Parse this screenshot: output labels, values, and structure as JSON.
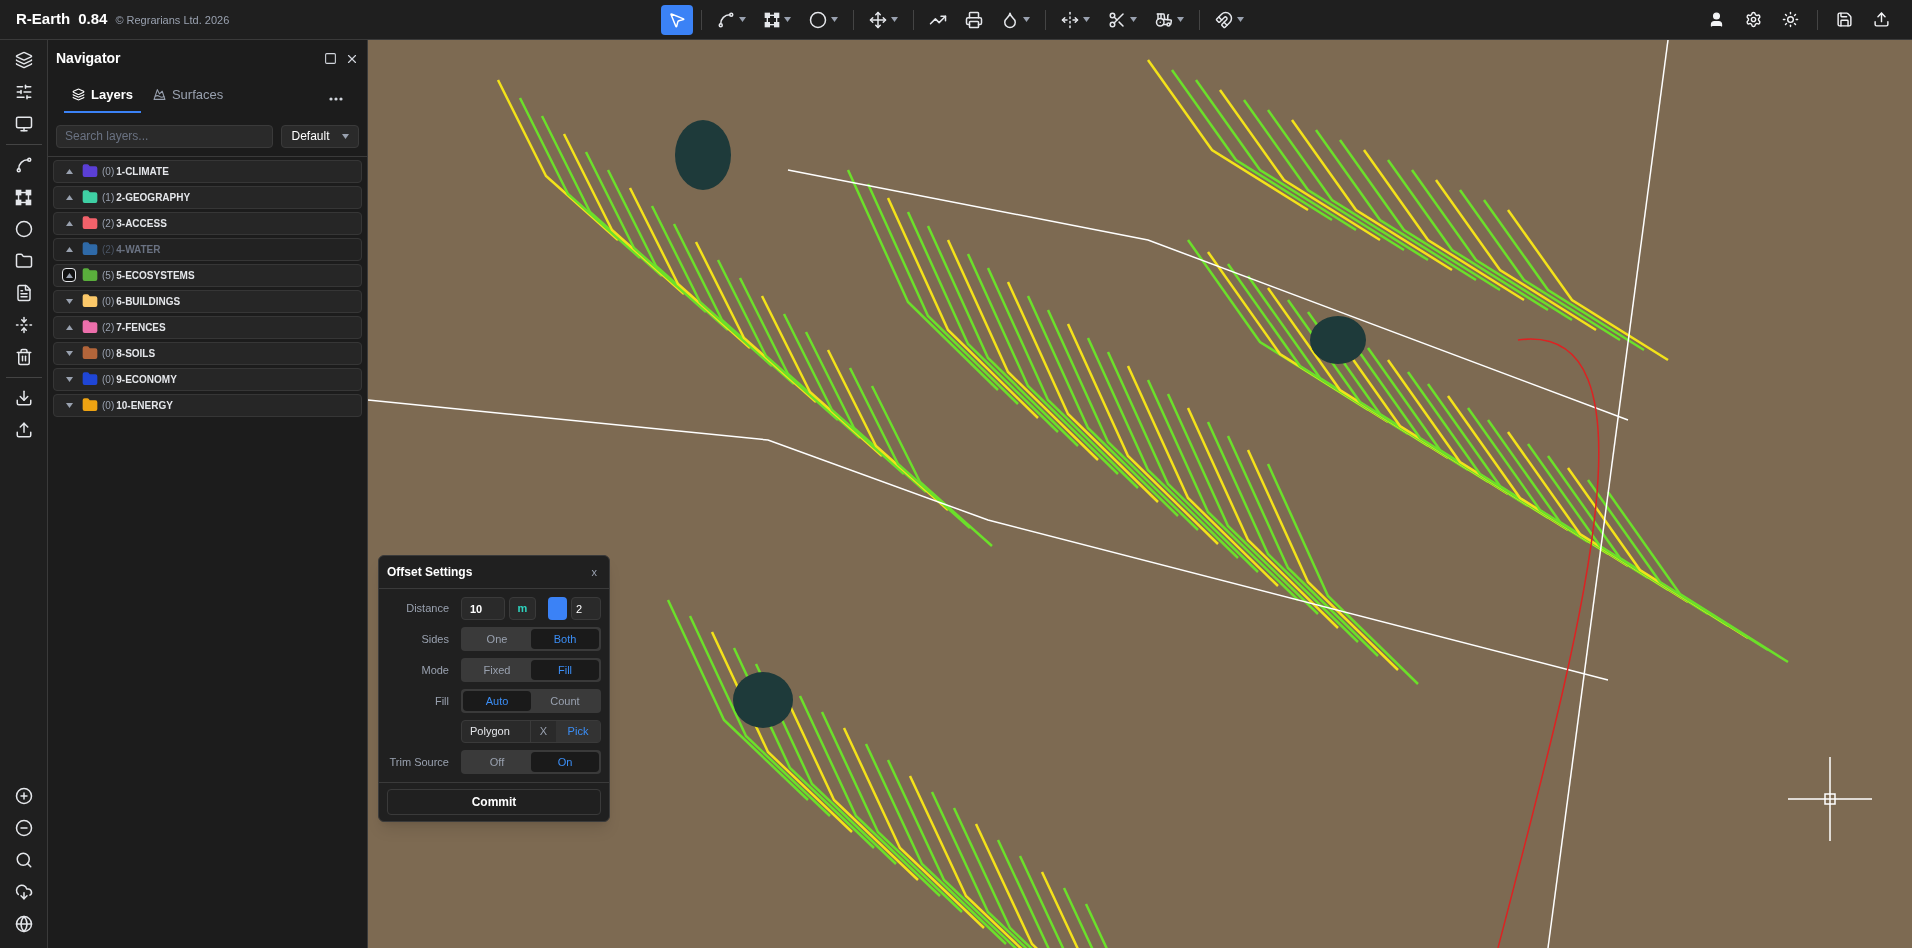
{
  "app": {
    "name": "R-Earth",
    "version": "0.84",
    "copyright": "© Regrarians Ltd. 2026"
  },
  "toolbar": [
    [
      {
        "selected": true,
        "dropdown": false
      }
    ],
    [
      {
        "selected": false,
        "dropdown": true
      },
      {
        "selected": false,
        "dropdown": true
      },
      {
        "selected": false,
        "dropdown": true
      }
    ],
    [
      {
        "selected": false,
        "dropdown": true
      }
    ],
    [
      {
        "selected": false,
        "dropdown": false
      },
      {
        "selected": false,
        "dropdown": false
      },
      {
        "selected": false,
        "dropdown": true
      }
    ],
    [
      {
        "selected": false,
        "dropdown": true
      },
      {
        "selected": false,
        "dropdown": true
      },
      {
        "selected": false,
        "dropdown": true
      }
    ],
    [
      {
        "selected": false,
        "dropdown": true
      }
    ]
  ],
  "navigator": {
    "title": "Navigator",
    "tabs": [
      {
        "label": "Layers",
        "selected": true
      },
      {
        "label": "Surfaces",
        "selected": false
      }
    ],
    "search": {
      "placeholder": "Search layers..."
    },
    "preset": "Default",
    "layers": [
      {
        "count": "(0)",
        "name": "1-CLIMATE",
        "color": "#5b3fd6",
        "expanded": true,
        "visible": true,
        "selected": false
      },
      {
        "count": "(1)",
        "name": "2-GEOGRAPHY",
        "color": "#3fd0a4",
        "expanded": true,
        "visible": true,
        "selected": false
      },
      {
        "count": "(2)",
        "name": "3-ACCESS",
        "color": "#f2626b",
        "expanded": true,
        "visible": true,
        "selected": false
      },
      {
        "count": "(2)",
        "name": "4-WATER",
        "color": "#2f6aa8",
        "expanded": true,
        "visible": false,
        "selected": false
      },
      {
        "count": "(5)",
        "name": "5-ECOSYSTEMS",
        "color": "#5aaf3c",
        "expanded": true,
        "visible": true,
        "selected": true
      },
      {
        "count": "(0)",
        "name": "6-BUILDINGS",
        "color": "#fcc96a",
        "expanded": false,
        "visible": true,
        "selected": false
      },
      {
        "count": "(2)",
        "name": "7-FENCES",
        "color": "#ec6fab",
        "expanded": true,
        "visible": true,
        "selected": false
      },
      {
        "count": "(0)",
        "name": "8-SOILS",
        "color": "#b3653a",
        "expanded": false,
        "visible": true,
        "selected": false
      },
      {
        "count": "(0)",
        "name": "9-ECONOMY",
        "color": "#1f46d6",
        "expanded": false,
        "visible": true,
        "selected": false
      },
      {
        "count": "(0)",
        "name": "10-ENERGY",
        "color": "#eea312",
        "expanded": false,
        "visible": true,
        "selected": false
      }
    ]
  },
  "offset_settings": {
    "title": "Offset Settings",
    "close": "x",
    "distance": {
      "label": "Distance",
      "value": "10",
      "unit": "m",
      "color": "#3b82f6",
      "count": "2"
    },
    "toggles": [
      {
        "label": "Sides",
        "options": [
          {
            "label": "One",
            "selected": false
          },
          {
            "label": "Both",
            "selected": true
          }
        ]
      },
      {
        "label": "Mode",
        "options": [
          {
            "label": "Fixed",
            "selected": false
          },
          {
            "label": "Fill",
            "selected": true
          }
        ]
      },
      {
        "label": "Fill",
        "options": [
          {
            "label": "Auto",
            "selected": true
          },
          {
            "label": "Count",
            "selected": false
          }
        ]
      }
    ],
    "polygon": {
      "value": "Polygon",
      "clear": "X",
      "pick": "Pick"
    },
    "trim": {
      "label": "Trim Source",
      "options": [
        {
          "label": "Off",
          "selected": false
        },
        {
          "label": "On",
          "selected": true
        }
      ]
    },
    "commit": "Commit"
  }
}
